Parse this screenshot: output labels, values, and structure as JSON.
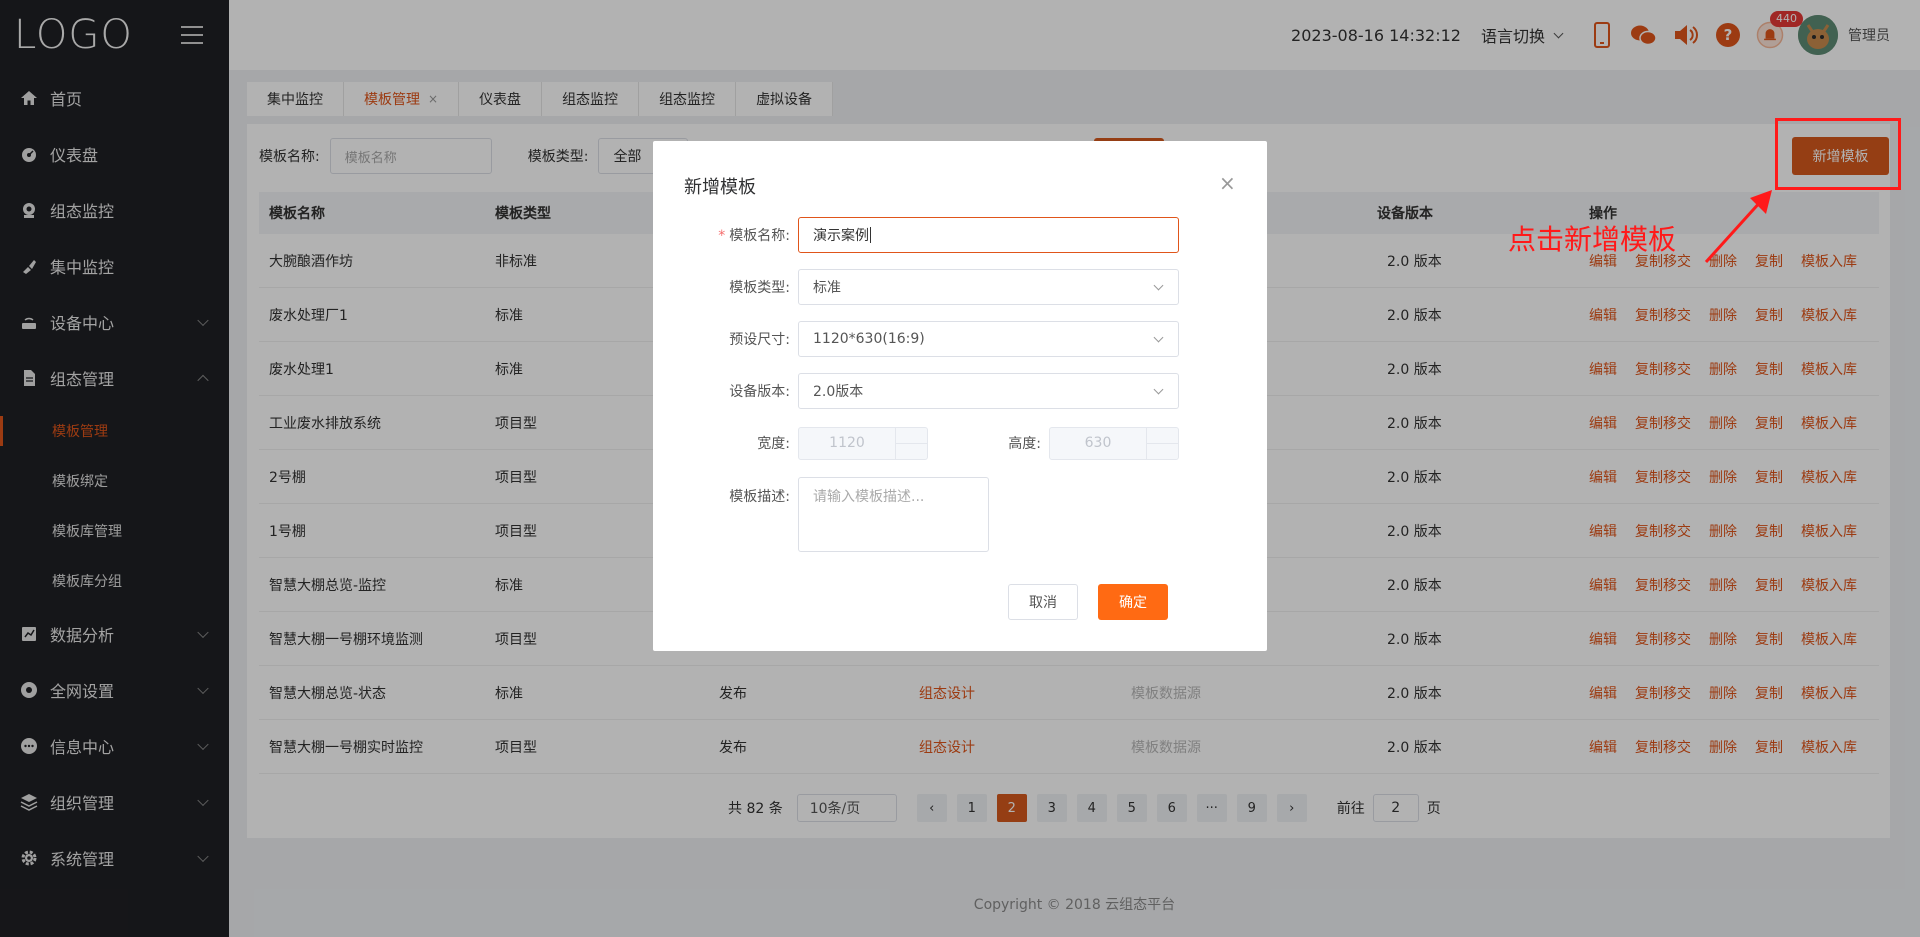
{
  "sidebar": {
    "logo": "LOGO",
    "menu": [
      {
        "label": "首页",
        "icon": "home-icon",
        "has_sub": false
      },
      {
        "label": "仪表盘",
        "icon": "dashboard-icon",
        "has_sub": false
      },
      {
        "label": "组态监控",
        "icon": "monitor-icon",
        "has_sub": false
      },
      {
        "label": "集中监控",
        "icon": "brush-icon",
        "has_sub": false
      },
      {
        "label": "设备中心",
        "icon": "router-icon",
        "has_sub": true
      },
      {
        "label": "组态管理",
        "icon": "document-icon",
        "has_sub": true,
        "expanded": true
      }
    ],
    "submenu": [
      {
        "label": "模板管理",
        "active": true
      },
      {
        "label": "模板绑定"
      },
      {
        "label": "模板库管理"
      },
      {
        "label": "模板库分组"
      }
    ],
    "menu_bottom": [
      {
        "label": "数据分析",
        "icon": "chart-icon"
      },
      {
        "label": "全网设置",
        "icon": "settings-circle-icon"
      },
      {
        "label": "信息中心",
        "icon": "chat-icon"
      },
      {
        "label": "组织管理",
        "icon": "layers-icon"
      },
      {
        "label": "系统管理",
        "icon": "gear-icon"
      }
    ]
  },
  "header": {
    "datetime": "2023-08-16 14:32:12",
    "language": "语言切换",
    "notification_count": "440",
    "user": "管理员"
  },
  "tabs": [
    {
      "label": "集中监控"
    },
    {
      "label": "模板管理",
      "active": true,
      "close": "×"
    },
    {
      "label": "仪表盘"
    },
    {
      "label": "组态监控"
    },
    {
      "label": "组态监控"
    },
    {
      "label": "虚拟设备"
    }
  ],
  "filter": {
    "name_label": "模板名称:",
    "name_placeholder": "模板名称",
    "type_label": "模板类型:",
    "type_value": "全部"
  },
  "add_button": "新增模板",
  "annotation": "点击新增模板",
  "table": {
    "columns": [
      "模板名称",
      "模板类型",
      "设备版本",
      "操作"
    ],
    "rows": [
      {
        "name": "大腕酿酒作坊",
        "type": "非标准",
        "status": "",
        "design": "",
        "source": "",
        "version": "2.0 版本"
      },
      {
        "name": "废水处理厂1",
        "type": "标准",
        "status": "",
        "design": "",
        "source": "",
        "version": "2.0 版本"
      },
      {
        "name": "废水处理1",
        "type": "标准",
        "status": "",
        "design": "",
        "source": "",
        "version": "2.0 版本"
      },
      {
        "name": "工业废水排放系统",
        "type": "项目型",
        "status": "",
        "design": "",
        "source": "",
        "version": "2.0 版本"
      },
      {
        "name": "2号棚",
        "type": "项目型",
        "status": "",
        "design": "",
        "source": "",
        "version": "2.0 版本"
      },
      {
        "name": "1号棚",
        "type": "项目型",
        "status": "",
        "design": "",
        "source": "",
        "version": "2.0 版本"
      },
      {
        "name": "智慧大棚总览-监控",
        "type": "标准",
        "status": "",
        "design": "",
        "source": "",
        "version": "2.0 版本"
      },
      {
        "name": "智慧大棚一号棚环境监测",
        "type": "项目型",
        "status": "",
        "design": "",
        "source": "",
        "version": "2.0 版本"
      },
      {
        "name": "智慧大棚总览-状态",
        "type": "标准",
        "status": "发布",
        "design": "组态设计",
        "source": "模板数据源",
        "version": "2.0 版本"
      },
      {
        "name": "智慧大棚一号棚实时监控",
        "type": "项目型",
        "status": "发布",
        "design": "组态设计",
        "source": "模板数据源",
        "version": "2.0 版本"
      }
    ],
    "operations": [
      "编辑",
      "复制移交",
      "删除",
      "复制",
      "模板入库"
    ]
  },
  "pagination": {
    "total": "共 82 条",
    "page_size": "10条/页",
    "pages": [
      "1",
      "2",
      "3",
      "4",
      "5",
      "6",
      "···",
      "9"
    ],
    "current": "2",
    "goto_label": "前往",
    "goto_value": "2",
    "goto_unit": "页"
  },
  "footer": "Copyright © 2018 云组态平台",
  "modal": {
    "title": "新增模板",
    "close": "×",
    "name_label": "模板名称:",
    "name_value": "演示案例",
    "type_label": "模板类型:",
    "type_value": "标准",
    "size_label": "预设尺寸:",
    "size_value": "1120*630(16:9)",
    "version_label": "设备版本:",
    "version_value": "2.0版本",
    "width_label": "宽度:",
    "width_value": "1120",
    "height_label": "高度:",
    "height_value": "630",
    "desc_label": "模板描述:",
    "desc_placeholder": "请输入模板描述...",
    "cancel": "取消",
    "ok": "确定"
  },
  "colors": {
    "accent": "#e0551a",
    "sidebar_bg": "#1f2024",
    "annotation": "#ff1a1a"
  }
}
